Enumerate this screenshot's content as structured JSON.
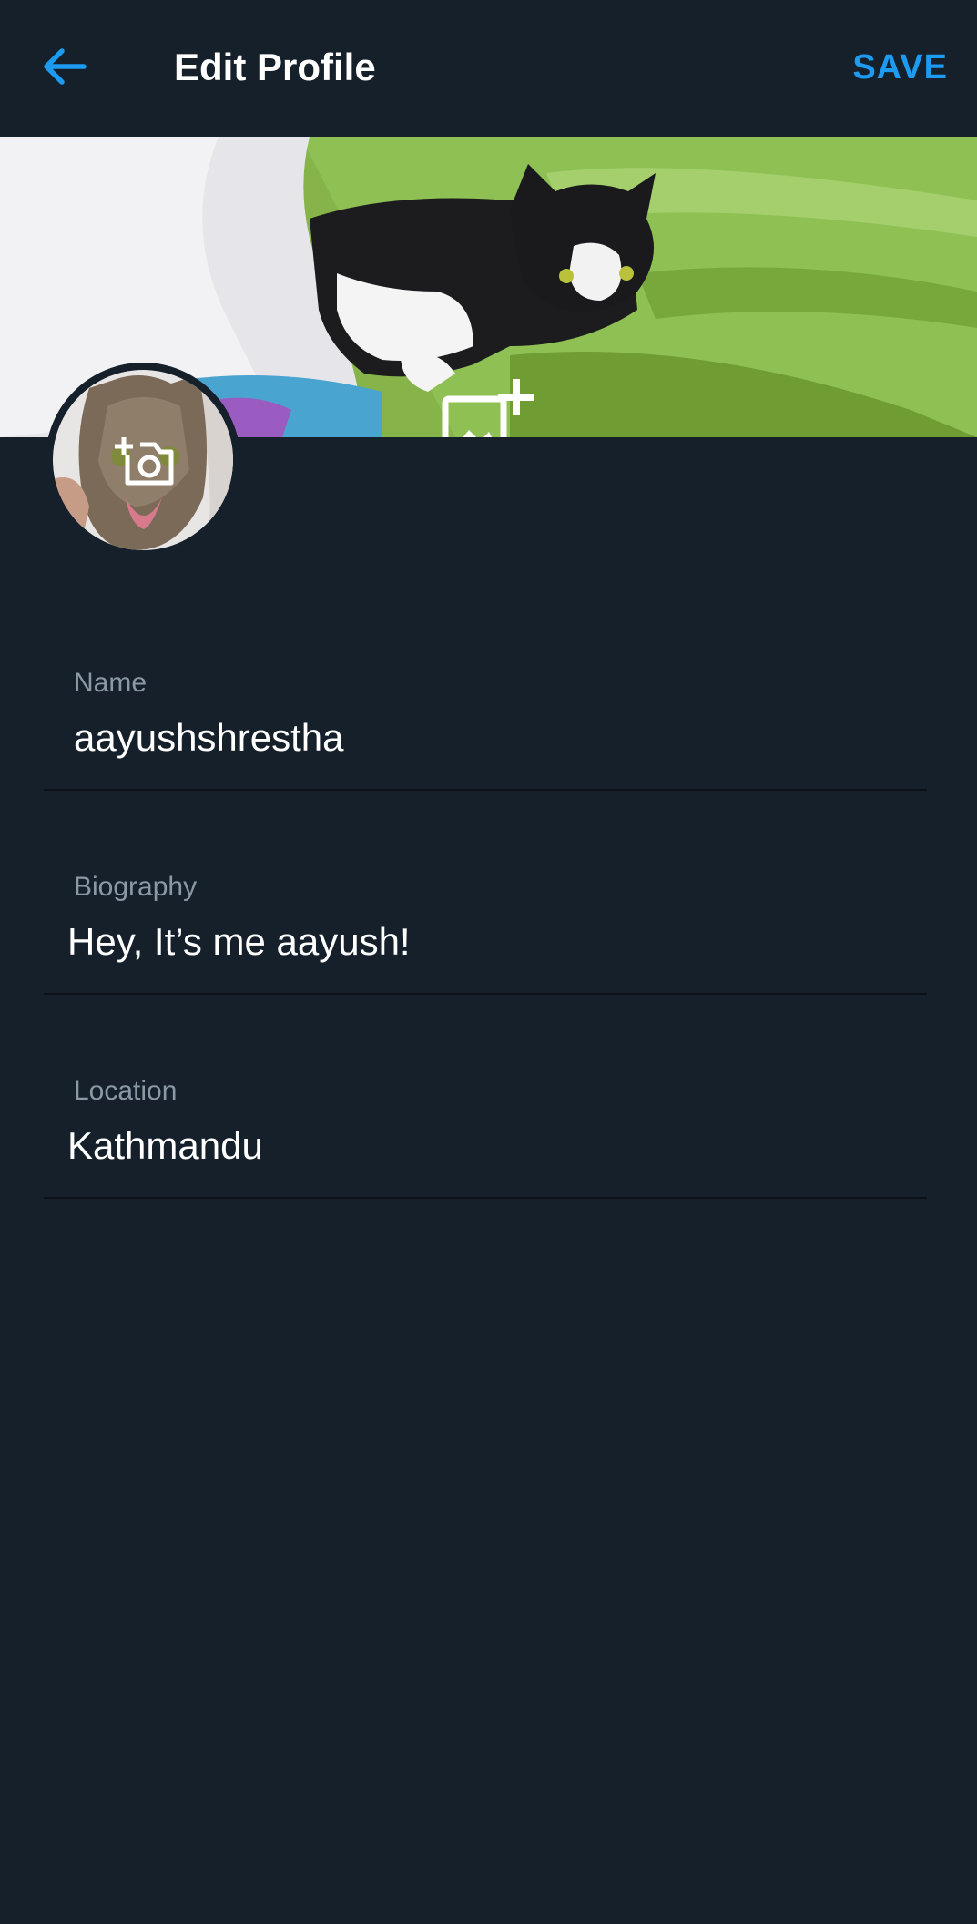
{
  "header": {
    "title": "Edit Profile",
    "save_label": "SAVE",
    "back_icon": "arrow-left-icon",
    "accent_color": "#1d9bf0"
  },
  "banner": {
    "add_photo_icon": "add-photo-icon"
  },
  "avatar": {
    "change_photo_icon": "camera-add-icon"
  },
  "fields": {
    "name": {
      "label": "Name",
      "value": "aayushshrestha"
    },
    "biography": {
      "label": "Biography",
      "value": "Hey, It’s me aayush!"
    },
    "location": {
      "label": "Location",
      "value": "Kathmandu"
    }
  },
  "theme": {
    "background": "#15202b",
    "divider": "#0b1117",
    "label_color": "#8b98a5",
    "text_color": "#ffffff"
  }
}
